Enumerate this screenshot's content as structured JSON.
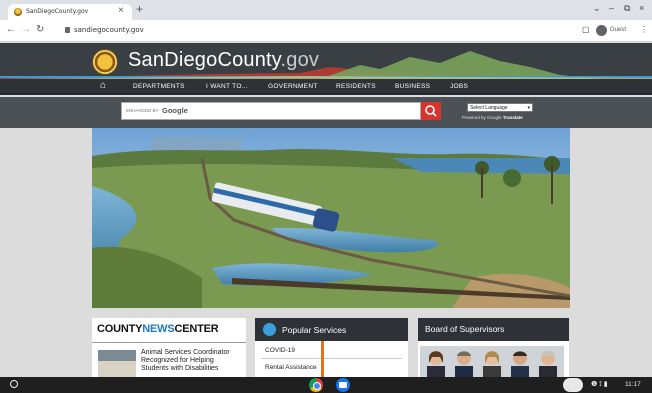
{
  "browser": {
    "tab_title": "SanDiegoCounty.gov",
    "tab_close": "×",
    "new_tab": "+",
    "address": "sandiegocounty.gov",
    "guest_label": "Guest",
    "window_controls": [
      "⌄",
      "–",
      "⧉",
      "×"
    ]
  },
  "site": {
    "logo_main": "SanDiegoCounty",
    "logo_suffix": ".gov",
    "nav": [
      "DEPARTMENTS",
      "I WANT TO...",
      "GOVERNMENT",
      "RESIDENTS",
      "BUSINESS",
      "JOBS"
    ],
    "search": {
      "powered_prefix": "ENHANCED BY",
      "powered_brand": "Google"
    },
    "language": {
      "selected": "Select Language",
      "powered_by": "Powered by",
      "google_word": "Google",
      "translate_word": "Translate"
    },
    "news": {
      "title_a": "COUNTY",
      "title_b": "NEWS",
      "title_c": "CENTER",
      "headline": "Animal Services Coordinator Recognized for Helping Students with Disabilities"
    },
    "popular": {
      "title": "Popular Services",
      "items": [
        "COVID-19",
        "Rental Assistance"
      ]
    },
    "board": {
      "title": "Board of Supervisors"
    }
  },
  "shelf": {
    "status_icons": "❶ ⟟ ▮",
    "time": "11:17"
  },
  "colors": {
    "accent_red": "#d9332b",
    "news_blue": "#1e78c2",
    "header_dark": "#2e3236"
  }
}
